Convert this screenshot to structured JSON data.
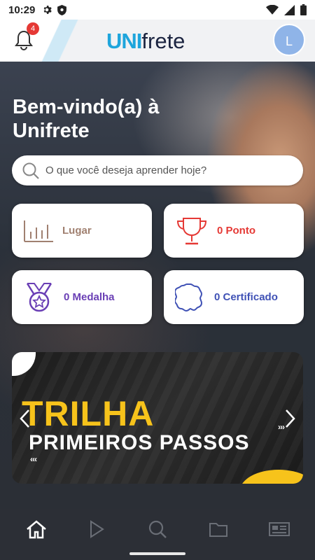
{
  "statusbar": {
    "time": "10:29"
  },
  "header": {
    "notification_count": "4",
    "logo_uni": "UNI",
    "logo_frete": "frete",
    "avatar_initial": "L"
  },
  "welcome": {
    "line1": "Bem-vindo(a) à",
    "line2": "Unifrete"
  },
  "search": {
    "placeholder": "O que você deseja aprender hoje?",
    "value": ""
  },
  "stats": [
    {
      "label": "Lugar",
      "icon": "bar-chart-icon",
      "color": "#a08070"
    },
    {
      "label": "0 Ponto",
      "icon": "trophy-icon",
      "color": "#e53935"
    },
    {
      "label": "0 Medalha",
      "icon": "medal-icon",
      "color": "#6a3fb5"
    },
    {
      "label": "0 Certificado",
      "icon": "certificate-icon",
      "color": "#3f51b5"
    }
  ],
  "banner": {
    "title_line1": "TRILHA",
    "title_line2": "PRIMEIROS PASSOS"
  },
  "bottom_nav": [
    {
      "icon": "home-icon",
      "active": true
    },
    {
      "icon": "play-icon",
      "active": false
    },
    {
      "icon": "search-icon",
      "active": false
    },
    {
      "icon": "folder-icon",
      "active": false
    },
    {
      "icon": "news-icon",
      "active": false
    }
  ]
}
